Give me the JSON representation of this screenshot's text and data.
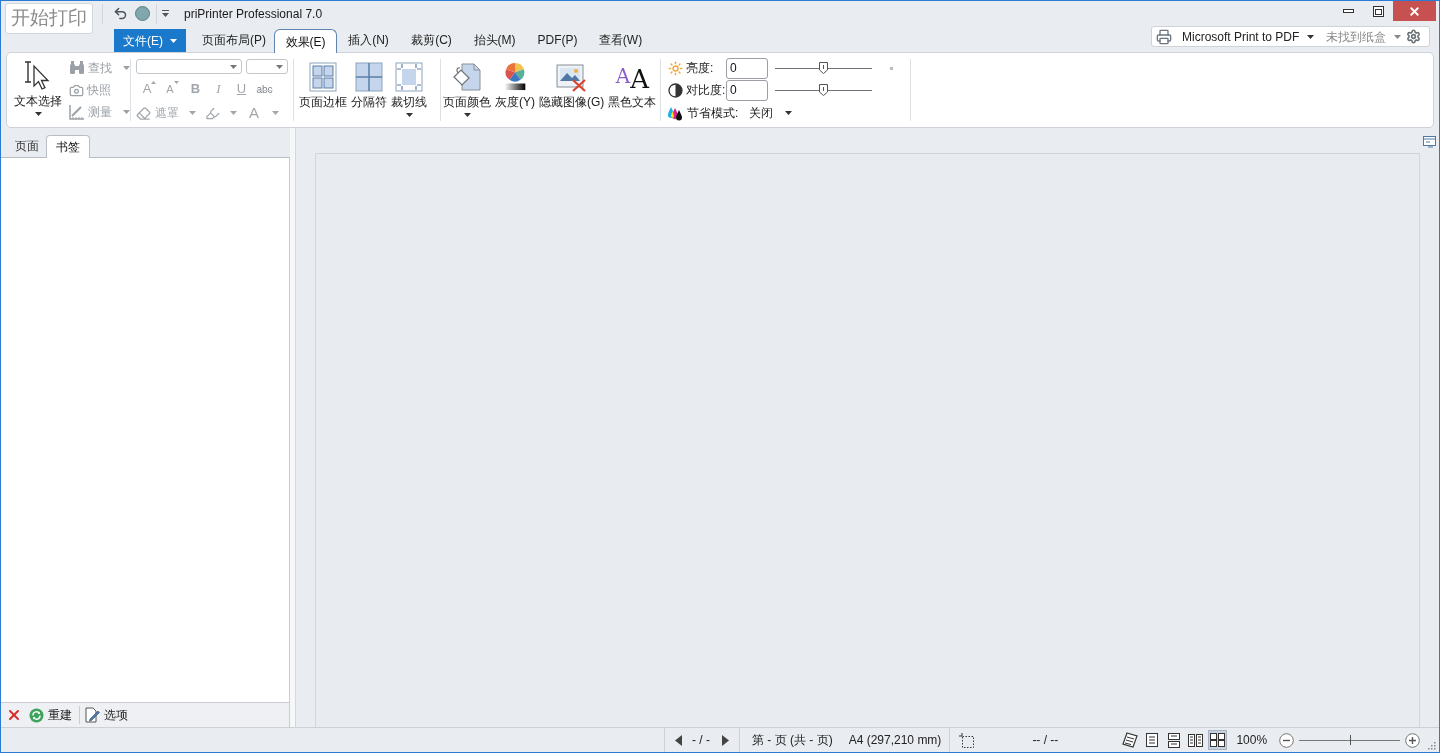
{
  "window": {
    "title": "priPrinter Professional 7.0"
  },
  "start_button": {
    "label": "开始打印"
  },
  "file_menu": {
    "label": "文件(E)"
  },
  "tabs": [
    {
      "label": "页面布局(P)",
      "selected": false
    },
    {
      "label": "效果(E)",
      "selected": true
    },
    {
      "label": "插入(N)",
      "selected": false
    },
    {
      "label": "裁剪(C)",
      "selected": false
    },
    {
      "label": "抬头(M)",
      "selected": false
    },
    {
      "label": "PDF(P)",
      "selected": false
    },
    {
      "label": "查看(W)",
      "selected": false
    }
  ],
  "printer_bar": {
    "printer": "Microsoft Print to PDF",
    "tray": "未找到纸盒"
  },
  "ribbon": {
    "select_tool": {
      "label": "文本选择"
    },
    "tools": [
      {
        "kind": "find",
        "label": "查找",
        "disabled": true,
        "dropdown": true
      },
      {
        "kind": "snapshot",
        "label": "快照",
        "disabled": true,
        "dropdown": false
      },
      {
        "kind": "measure",
        "label": "测量",
        "disabled": true,
        "dropdown": true
      }
    ],
    "text_format": {
      "disabled": true,
      "buttons": [
        {
          "kind": "grow",
          "label": "A"
        },
        {
          "kind": "shrink",
          "label": "A"
        },
        {
          "kind": "bold",
          "label": "B"
        },
        {
          "kind": "italic",
          "label": "I"
        },
        {
          "kind": "underline",
          "label": "U"
        },
        {
          "kind": "strike",
          "label": "abc"
        }
      ],
      "tools": [
        {
          "kind": "mask",
          "label": "遮罩",
          "dropdown": true
        },
        {
          "kind": "highlight",
          "dropdown": true
        },
        {
          "kind": "font_color",
          "label": "A",
          "dropdown": true
        }
      ]
    },
    "effects": [
      {
        "kind": "border",
        "label": "页面边框",
        "dropdown": false
      },
      {
        "kind": "separator",
        "label": "分隔符",
        "dropdown": false
      },
      {
        "kind": "crop_marks",
        "label": "裁切线",
        "dropdown": true
      }
    ],
    "colors": [
      {
        "kind": "page_color",
        "label": "页面颜色",
        "dropdown": true
      },
      {
        "kind": "grayscale",
        "label": "灰度(Y)",
        "dropdown": false
      },
      {
        "kind": "hide_images",
        "label": "隐藏图像(G)",
        "dropdown": false
      },
      {
        "kind": "black_text",
        "label": "黑色文本",
        "glyphs": [
          "A",
          "A"
        ],
        "dropdown": false
      }
    ],
    "adjust": [
      {
        "kind": "brightness",
        "label": "亮度:",
        "value": "0",
        "level": 0.5
      },
      {
        "kind": "contrast",
        "label": "对比度:",
        "value": "0",
        "level": 0.5
      }
    ],
    "saving_mode": {
      "label": "节省模式:",
      "value": "关闭"
    }
  },
  "side_panel": {
    "tabs": [
      {
        "label": "页面",
        "selected": false
      },
      {
        "label": "书签",
        "selected": true
      }
    ],
    "actions": [
      {
        "kind": "delete"
      },
      {
        "kind": "rebuild",
        "label": "重建"
      },
      {
        "kind": "options",
        "label": "选项"
      }
    ]
  },
  "status_bar": {
    "page_nav": "- / -",
    "page_info": "第 - 页 (共 - 页)",
    "paper": "A4 (297,210 mm)",
    "position": "-- / --",
    "views": [
      {
        "kind": "booklet",
        "selected": false
      },
      {
        "kind": "single",
        "selected": false
      },
      {
        "kind": "continuous",
        "selected": false
      },
      {
        "kind": "two_page",
        "selected": false
      },
      {
        "kind": "multi",
        "selected": true
      }
    ],
    "zoom": {
      "label": "100%",
      "level": 0.5
    }
  }
}
